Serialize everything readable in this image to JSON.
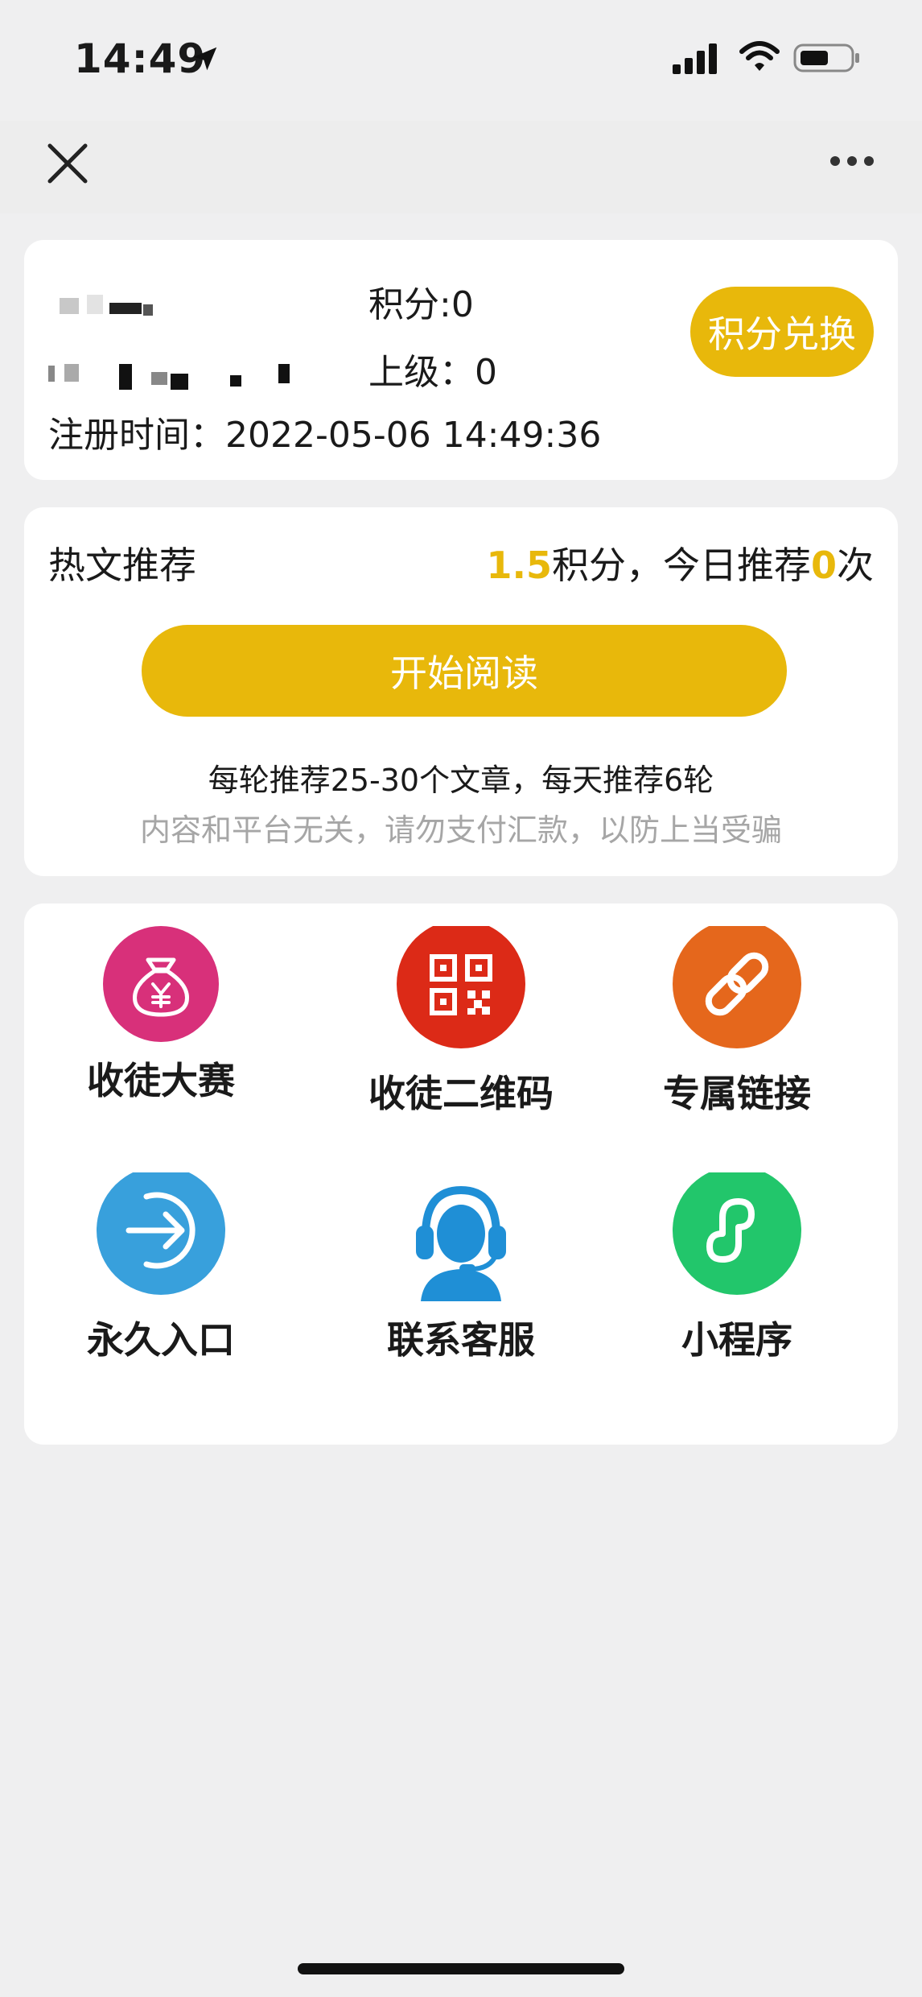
{
  "status_bar": {
    "time": "14:49"
  },
  "user_card": {
    "points_label": "积分:0",
    "superior_label": "上级：0",
    "register_label": "注册时间：",
    "register_time": "2022-05-06 14:49:36",
    "exchange_button": "积分兑换"
  },
  "recommend": {
    "title": "热文推荐",
    "points_value": "1.5",
    "points_text": "积分，今日推荐",
    "today_count": "0",
    "count_unit": "次",
    "start_button": "开始阅读",
    "note": "每轮推荐25-30个文章，每天推荐6轮",
    "warning": "内容和平台无关，请勿支付汇款，以防上当受骗"
  },
  "grid": {
    "items": [
      {
        "label": "收徒大赛",
        "icon": "money-bag-icon",
        "color": "#d8307a"
      },
      {
        "label": "收徒二维码",
        "icon": "qr-code-icon",
        "color": "#dc2a17"
      },
      {
        "label": "专属链接",
        "icon": "link-icon",
        "color": "#e5671c"
      },
      {
        "label": "永久入口",
        "icon": "enter-icon",
        "color": "#38a0dc"
      },
      {
        "label": "联系客服",
        "icon": "customer-service-icon",
        "color": "#1f8fd6"
      },
      {
        "label": "小程序",
        "icon": "mini-program-icon",
        "color": "#22c66b"
      }
    ]
  },
  "colors": {
    "accent": "#e8b80b",
    "background": "#efeff0"
  }
}
